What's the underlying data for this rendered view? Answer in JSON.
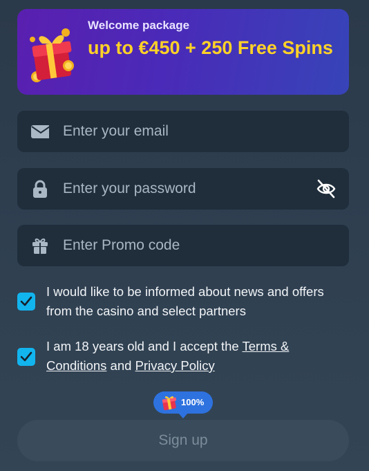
{
  "banner": {
    "label": "Welcome package",
    "offer": "up to €450 + 250 Free Spins",
    "icon": "gift-box-with-coins-icon"
  },
  "form": {
    "email": {
      "placeholder": "Enter your email",
      "value": "",
      "icon": "envelope-icon"
    },
    "password": {
      "placeholder": "Enter your password",
      "value": "",
      "icon": "lock-icon",
      "toggle_icon": "eye-slash-icon"
    },
    "promo": {
      "placeholder": "Enter Promo code",
      "value": "",
      "icon": "gift-icon"
    },
    "news_consent": {
      "checked": true,
      "text": "I would like to be informed about news and offers from the casino and select partners"
    },
    "age_consent": {
      "checked": true,
      "prefix": "I am 18 years old and I accept the ",
      "terms_link": "Terms & Conditions",
      "middle": " and ",
      "privacy_link": "Privacy Policy"
    },
    "bonus_badge": {
      "text": "100%",
      "icon": "gift-icon"
    },
    "signup_label": "Sign up"
  },
  "colors": {
    "background": "#2f3f50",
    "field": "#202e3b",
    "checkbox": "#12b4ee",
    "accent_yellow": "#ffd227",
    "badge": "#2e72e0",
    "button_disabled": "#3a4b5b"
  }
}
